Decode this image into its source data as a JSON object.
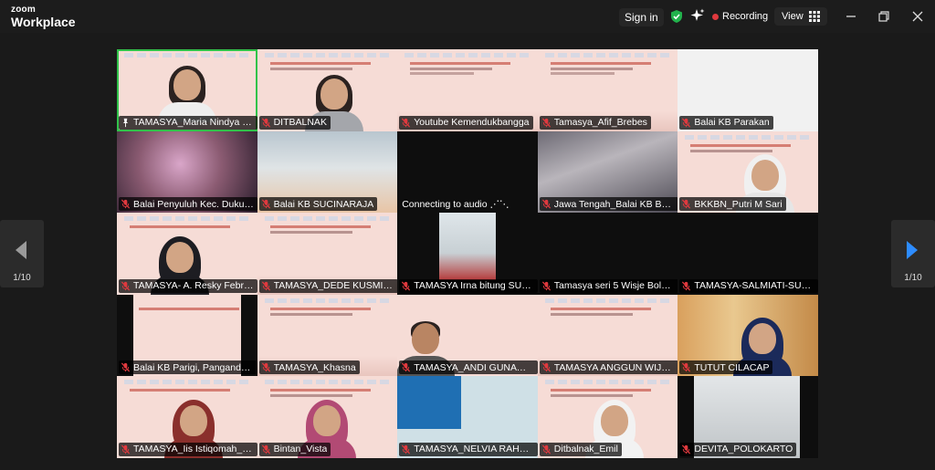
{
  "app": {
    "brand_top": "zoom",
    "brand_bottom": "Workplace"
  },
  "topbar": {
    "sign_in": "Sign in",
    "recording": "Recording",
    "view": "View",
    "icons": [
      "shield-check-icon",
      "sparkle-icon",
      "grid-icon",
      "minimize-icon",
      "restore-icon",
      "close-icon"
    ]
  },
  "pager": {
    "left": "1/10",
    "right": "1/10"
  },
  "colors": {
    "active_speaker": "#31c24a",
    "recording_dot": "#e0393e",
    "mute": "#e0393e"
  },
  "tiles": [
    {
      "name": "TAMASYA_Maria Nindya K_K...",
      "muted": false,
      "pinned": true
    },
    {
      "name": "DITBALNAK",
      "muted": true
    },
    {
      "name": "Youtube Kemendukbangga",
      "muted": true
    },
    {
      "name": "Tamasya_Afif_Brebes",
      "muted": true
    },
    {
      "name": "Balai KB Parakan",
      "muted": true
    },
    {
      "name": "Balai Penyuluh Kec. Dukuht...",
      "muted": true
    },
    {
      "name": "Balai KB SUCINARAJA",
      "muted": true
    },
    {
      "status": "Connecting to audio"
    },
    {
      "name": "Jawa Tengah_Balai KB Bany...",
      "muted": true
    },
    {
      "name": "BKKBN_Putri M Sari",
      "muted": true
    },
    {
      "name": "TAMASYA- A. Resky Febriani...",
      "muted": true
    },
    {
      "name": "TAMASYA_DEDE KUSMIATI_...",
      "muted": true
    },
    {
      "name": "TAMASYA Irna bitung SULUT",
      "muted": true
    },
    {
      "name": "Tamasya seri 5  Wisje Bolohr...",
      "muted": true
    },
    {
      "name": "TAMASYA-SALMIATI-SULSEL",
      "muted": true
    },
    {
      "name": "Balai KB Parigi, Pangandaran",
      "muted": true
    },
    {
      "name": "TAMASYA_Khasna",
      "muted": true
    },
    {
      "name": "TAMASYA_ANDI GUNAWAN,...",
      "muted": true
    },
    {
      "name": "TAMASYA ANGGUN WIJAYA ...",
      "muted": true
    },
    {
      "name": "TUTUT  CILACAP",
      "muted": true
    },
    {
      "name": "TAMASYA_Iis Istiqomah_Jaw...",
      "muted": true
    },
    {
      "name": "Bintan_Vista",
      "muted": true
    },
    {
      "name": "TAMASYA_NELVIA RAHMI_S...",
      "muted": true
    },
    {
      "name": "Ditbalnak_Emil",
      "muted": true
    },
    {
      "name": "DEVITA_POLOKARTO",
      "muted": true
    }
  ]
}
